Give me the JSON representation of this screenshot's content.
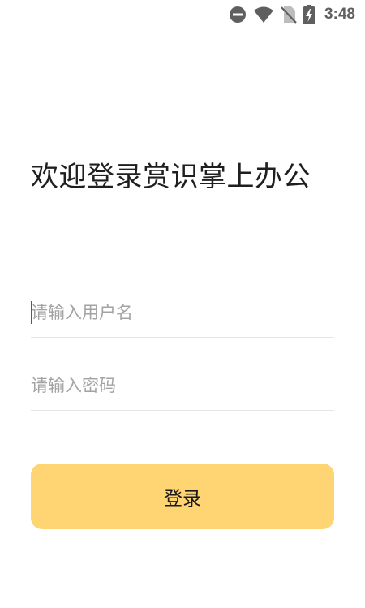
{
  "status_bar": {
    "time": "3:48",
    "icons": [
      "do-not-disturb-icon",
      "wifi-icon",
      "no-sim-icon",
      "battery-charging-icon"
    ]
  },
  "login": {
    "title": "欢迎登录赏识掌上办公",
    "username_placeholder": "请输入用户名",
    "username_value": "",
    "password_placeholder": "请输入密码",
    "password_value": "",
    "submit_label": "登录"
  },
  "colors": {
    "button_bg": "#ffd473",
    "title_text": "#1f1f1f",
    "placeholder_text": "#a3a3a3",
    "divider": "#e6e6e6",
    "status_icons": "#5f5f5f"
  }
}
